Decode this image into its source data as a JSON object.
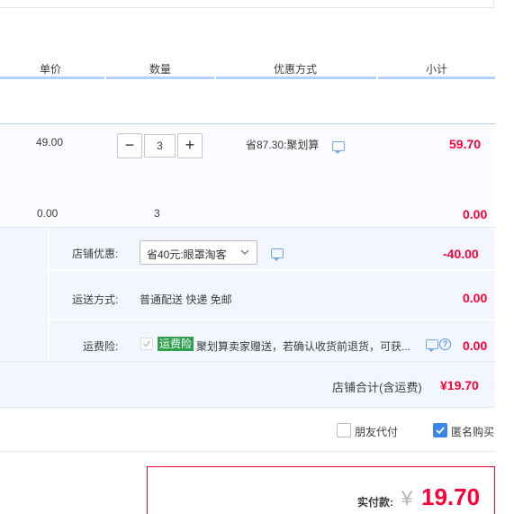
{
  "header": {
    "unit_price": "单价",
    "quantity": "数量",
    "discount_method": "优惠方式",
    "subtotal": "小计"
  },
  "item": {
    "unit_price": "49.00",
    "quantity": "3",
    "minus": "−",
    "plus": "+",
    "discount": "省87.30:聚划算",
    "subtotal": "59.70"
  },
  "item2": {
    "unit_price": "0.00",
    "quantity": "3",
    "subtotal": "0.00"
  },
  "shop": {
    "discount_label": "店铺优惠:",
    "discount_select": "省40元:眼罩淘客",
    "discount_amount": "-40.00",
    "shipping_label": "运送方式:",
    "shipping_value": "普通配送 快递 免邮",
    "shipping_amount": "0.00",
    "insurance_label": "运费险:",
    "insurance_badge": "运费险",
    "insurance_text": "聚划算卖家赠送，若确认收货前退货，可获...",
    "insurance_amount": "0.00",
    "total_label": "店铺合计(含运费)",
    "total_amount": "¥19.70"
  },
  "options": {
    "friend_pay": "朋友代付",
    "friend_pay_checked": false,
    "anonymous": "匿名购买",
    "anonymous_checked": true
  },
  "payment": {
    "label": "实付款:",
    "currency": "¥",
    "amount": "19.70"
  },
  "colors": {
    "accent_blue": "#3a85e8",
    "price_red": "#ff0036",
    "discount_orange": "#f40",
    "insurance_green": "#2f9e4f"
  }
}
